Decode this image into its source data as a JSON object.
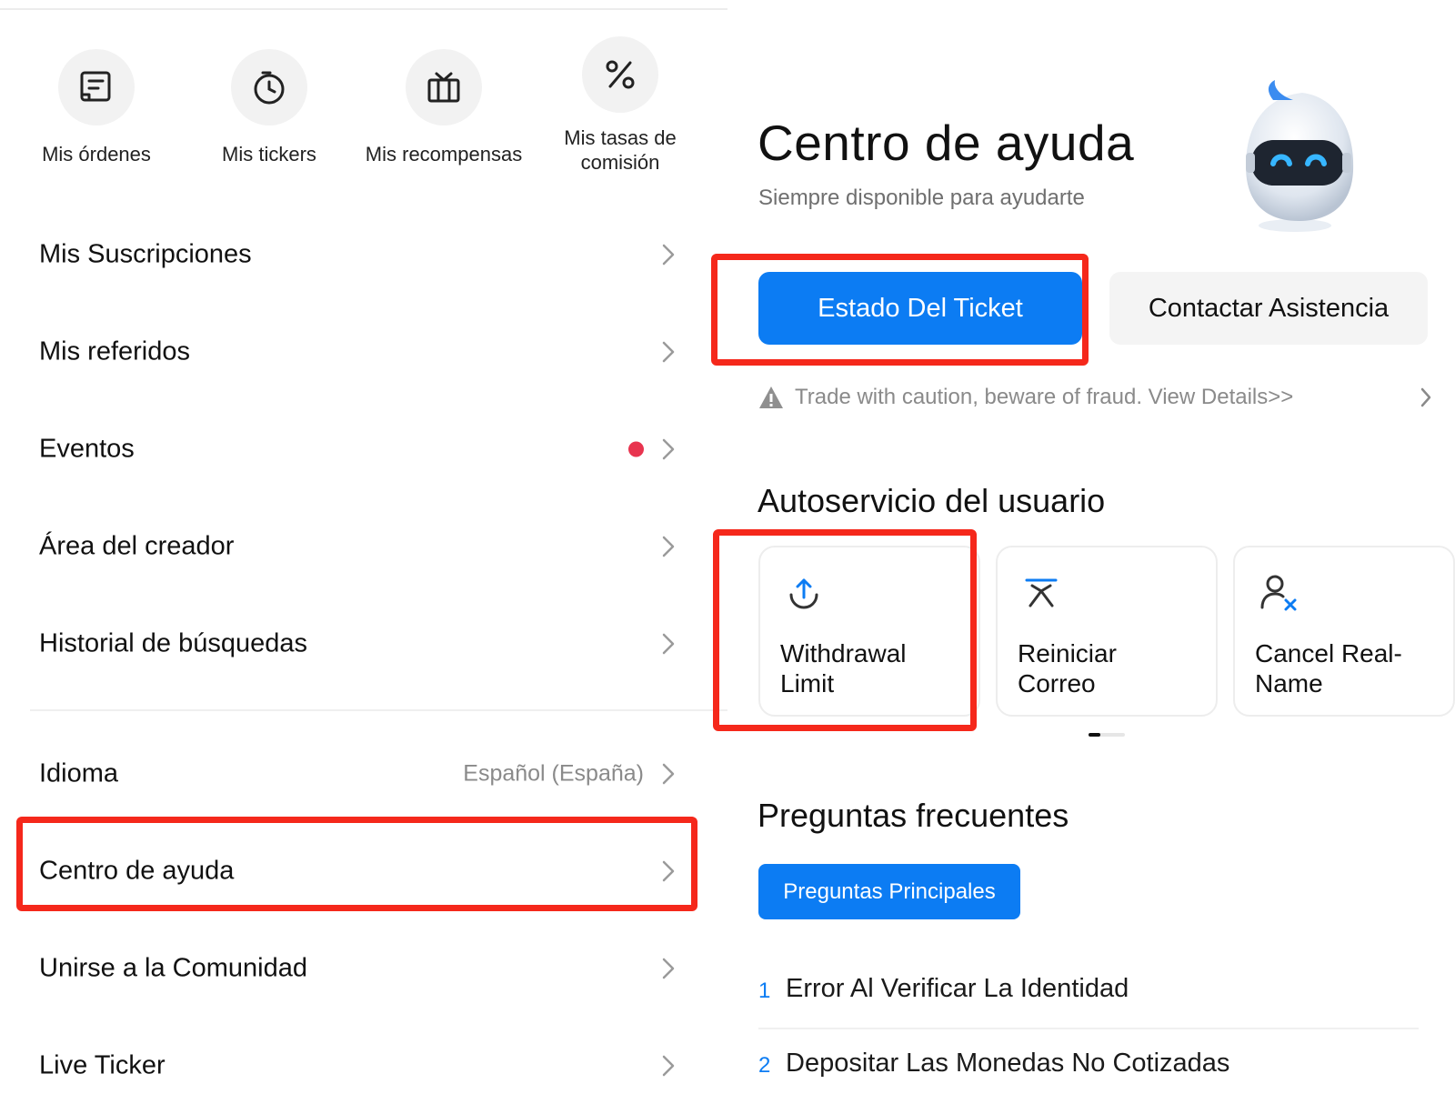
{
  "left": {
    "shortcuts": [
      {
        "label": "Mis órdenes",
        "icon": "orders-icon"
      },
      {
        "label": "Mis tickers",
        "icon": "clock-icon"
      },
      {
        "label": "Mis recompensas",
        "icon": "gift-icon"
      },
      {
        "label": "Mis tasas de comisión",
        "icon": "percent-icon"
      }
    ],
    "menu": [
      {
        "label": "Mis Suscripciones"
      },
      {
        "label": "Mis referidos"
      },
      {
        "label": "Eventos",
        "has_dot": true
      },
      {
        "label": "Área del creador"
      },
      {
        "label": "Historial de búsquedas"
      },
      {
        "label": "Idioma",
        "value": "Español (España)"
      },
      {
        "label": "Centro de ayuda",
        "highlighted": true
      },
      {
        "label": "Unirse a la Comunidad"
      },
      {
        "label": "Live Ticker"
      }
    ]
  },
  "help": {
    "title": "Centro de ayuda",
    "subtitle": "Siempre disponible para ayudarte",
    "ticket_button": "Estado Del Ticket",
    "contact_button": "Contactar Asistencia",
    "notice": "Trade with caution, beware of fraud. View Details>>",
    "self_service_title": "Autoservicio del usuario",
    "cards": [
      {
        "label": "Withdrawal Limit",
        "icon": "upload-arrow-icon"
      },
      {
        "label": "Reiniciar Correo",
        "icon": "reset-icon"
      },
      {
        "label": "Cancel Real-Name",
        "icon": "user-remove-icon"
      }
    ],
    "faq_title": "Preguntas frecuentes",
    "faq_tab": "Preguntas Principales",
    "faq_items": [
      {
        "num": "1",
        "text": "Error Al Verificar La Identidad"
      },
      {
        "num": "2",
        "text": "Depositar Las Monedas No Cotizadas"
      }
    ]
  },
  "colors": {
    "accent": "#0c7cf3",
    "highlight_box": "#f5281b",
    "notification_dot": "#e8344f"
  }
}
